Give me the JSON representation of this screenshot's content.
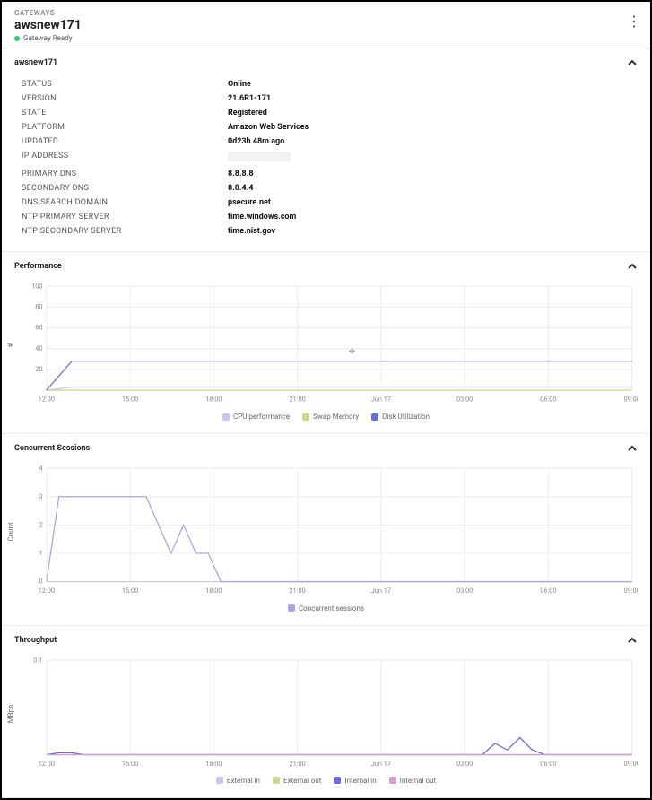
{
  "header": {
    "crumb": "GATEWAYS",
    "title": "awsnew171",
    "status_label": "Gateway Ready"
  },
  "details": {
    "panel_title": "awsnew171",
    "rows": [
      {
        "key": "STATUS",
        "val": "Online"
      },
      {
        "key": "VERSION",
        "val": "21.6R1-171"
      },
      {
        "key": "STATE",
        "val": "Registered"
      },
      {
        "key": "PLATFORM",
        "val": "Amazon Web Services"
      },
      {
        "key": "UPDATED",
        "val": "0d23h 48m ago"
      },
      {
        "key": "IP ADDRESS",
        "val": ""
      },
      {
        "key": "PRIMARY DNS",
        "val": "8.8.8.8"
      },
      {
        "key": "SECONDARY DNS",
        "val": "8.8.4.4"
      },
      {
        "key": "DNS SEARCH DOMAIN",
        "val": "psecure.net"
      },
      {
        "key": "NTP PRIMARY SERVER",
        "val": "time.windows.com"
      },
      {
        "key": "NTP SECONDARY SERVER",
        "val": "time.nist.gov"
      }
    ]
  },
  "chart_data": [
    {
      "id": "performance",
      "title": "Performance",
      "type": "line",
      "ylabel": "#",
      "ylim": [
        0,
        100
      ],
      "yticks": [
        20,
        40,
        60,
        80,
        100
      ],
      "xticks": [
        "12:00",
        "15:00",
        "18:00",
        "21:00",
        "Jun 17",
        "03:00",
        "06:00",
        "09:00"
      ],
      "series": [
        {
          "name": "CPU performance",
          "color": "#c9c6f2",
          "values": [
            0,
            3,
            3,
            3,
            3,
            3,
            3,
            3,
            3,
            3,
            3,
            3,
            3,
            3,
            3,
            3,
            3,
            3,
            3,
            3,
            3,
            3,
            3,
            3
          ]
        },
        {
          "name": "Swap Memory",
          "color": "#c8d98a",
          "values": [
            0,
            0,
            0,
            0,
            0,
            0,
            0,
            0,
            0,
            0,
            0,
            0,
            0,
            0,
            0,
            0,
            0,
            0,
            0,
            0,
            0,
            0,
            0,
            0
          ]
        },
        {
          "name": "Disk Utilization",
          "color": "#6e6ad8",
          "values": [
            0,
            28,
            28,
            28,
            28,
            28,
            28,
            28,
            28,
            28,
            28,
            28,
            28,
            28,
            28,
            28,
            28,
            28,
            28,
            28,
            28,
            28,
            28,
            28
          ]
        }
      ],
      "annotation": {
        "x_index": 12,
        "glyph": "✥"
      }
    },
    {
      "id": "sessions",
      "title": "Concurrent Sessions",
      "type": "line",
      "ylabel": "Count",
      "ylim": [
        0,
        4
      ],
      "yticks": [
        0,
        1,
        2,
        3,
        4
      ],
      "xticks": [
        "12:00",
        "15:00",
        "18:00",
        "21:00",
        "Jun 17",
        "03:00",
        "06:00",
        "09:00"
      ],
      "series": [
        {
          "name": "Concurrent sessions",
          "color": "#a9a3e8",
          "values": [
            0,
            3,
            3,
            3,
            3,
            3,
            3,
            3,
            3,
            2,
            1,
            2,
            1,
            1,
            0,
            0,
            0,
            0,
            0,
            0,
            0,
            0,
            0,
            0,
            0,
            0,
            0,
            0,
            0,
            0,
            0,
            0,
            0,
            0,
            0,
            0,
            0,
            0,
            0,
            0,
            0,
            0,
            0,
            0,
            0,
            0,
            0,
            0
          ]
        }
      ]
    },
    {
      "id": "throughput",
      "title": "Throughput",
      "type": "line",
      "ylabel": "MBps",
      "ylim": [
        0,
        0.1
      ],
      "yticks": [
        0.1
      ],
      "xticks": [
        "12:00",
        "15:00",
        "18:00",
        "21:00",
        "Jun 17",
        "03:00",
        "06:00",
        "09:00"
      ],
      "series": [
        {
          "name": "External in",
          "color": "#c9c6f2",
          "values": [
            0,
            0,
            0,
            0,
            0,
            0,
            0,
            0,
            0,
            0,
            0,
            0,
            0,
            0,
            0,
            0,
            0,
            0,
            0,
            0,
            0,
            0,
            0,
            0,
            0,
            0,
            0,
            0,
            0,
            0,
            0,
            0,
            0,
            0,
            0,
            0,
            0,
            0,
            0,
            0,
            0,
            0,
            0,
            0,
            0,
            0,
            0,
            0
          ]
        },
        {
          "name": "External out",
          "color": "#c8d98a",
          "values": [
            0,
            0,
            0,
            0,
            0,
            0,
            0,
            0,
            0,
            0,
            0,
            0,
            0,
            0,
            0,
            0,
            0,
            0,
            0,
            0,
            0,
            0,
            0,
            0,
            0,
            0,
            0,
            0,
            0,
            0,
            0,
            0,
            0,
            0,
            0,
            0,
            0,
            0,
            0,
            0,
            0,
            0,
            0,
            0,
            0,
            0,
            0,
            0
          ]
        },
        {
          "name": "Internal in",
          "color": "#6e6ad8",
          "values": [
            0,
            0.002,
            0.002,
            0,
            0,
            0,
            0,
            0,
            0,
            0,
            0,
            0,
            0,
            0,
            0,
            0,
            0,
            0,
            0,
            0,
            0,
            0,
            0,
            0,
            0,
            0,
            0,
            0,
            0,
            0,
            0,
            0,
            0,
            0,
            0,
            0,
            0.012,
            0.005,
            0.018,
            0.005,
            0,
            0,
            0,
            0,
            0,
            0,
            0,
            0
          ]
        },
        {
          "name": "Internal out",
          "color": "#d99ad1",
          "values": [
            0,
            0,
            0,
            0,
            0,
            0,
            0,
            0,
            0,
            0,
            0,
            0,
            0,
            0,
            0,
            0,
            0,
            0,
            0,
            0,
            0,
            0,
            0,
            0,
            0,
            0,
            0,
            0,
            0,
            0,
            0,
            0,
            0,
            0,
            0,
            0,
            0,
            0,
            0,
            0,
            0,
            0,
            0,
            0,
            0,
            0,
            0,
            0
          ]
        }
      ]
    }
  ]
}
